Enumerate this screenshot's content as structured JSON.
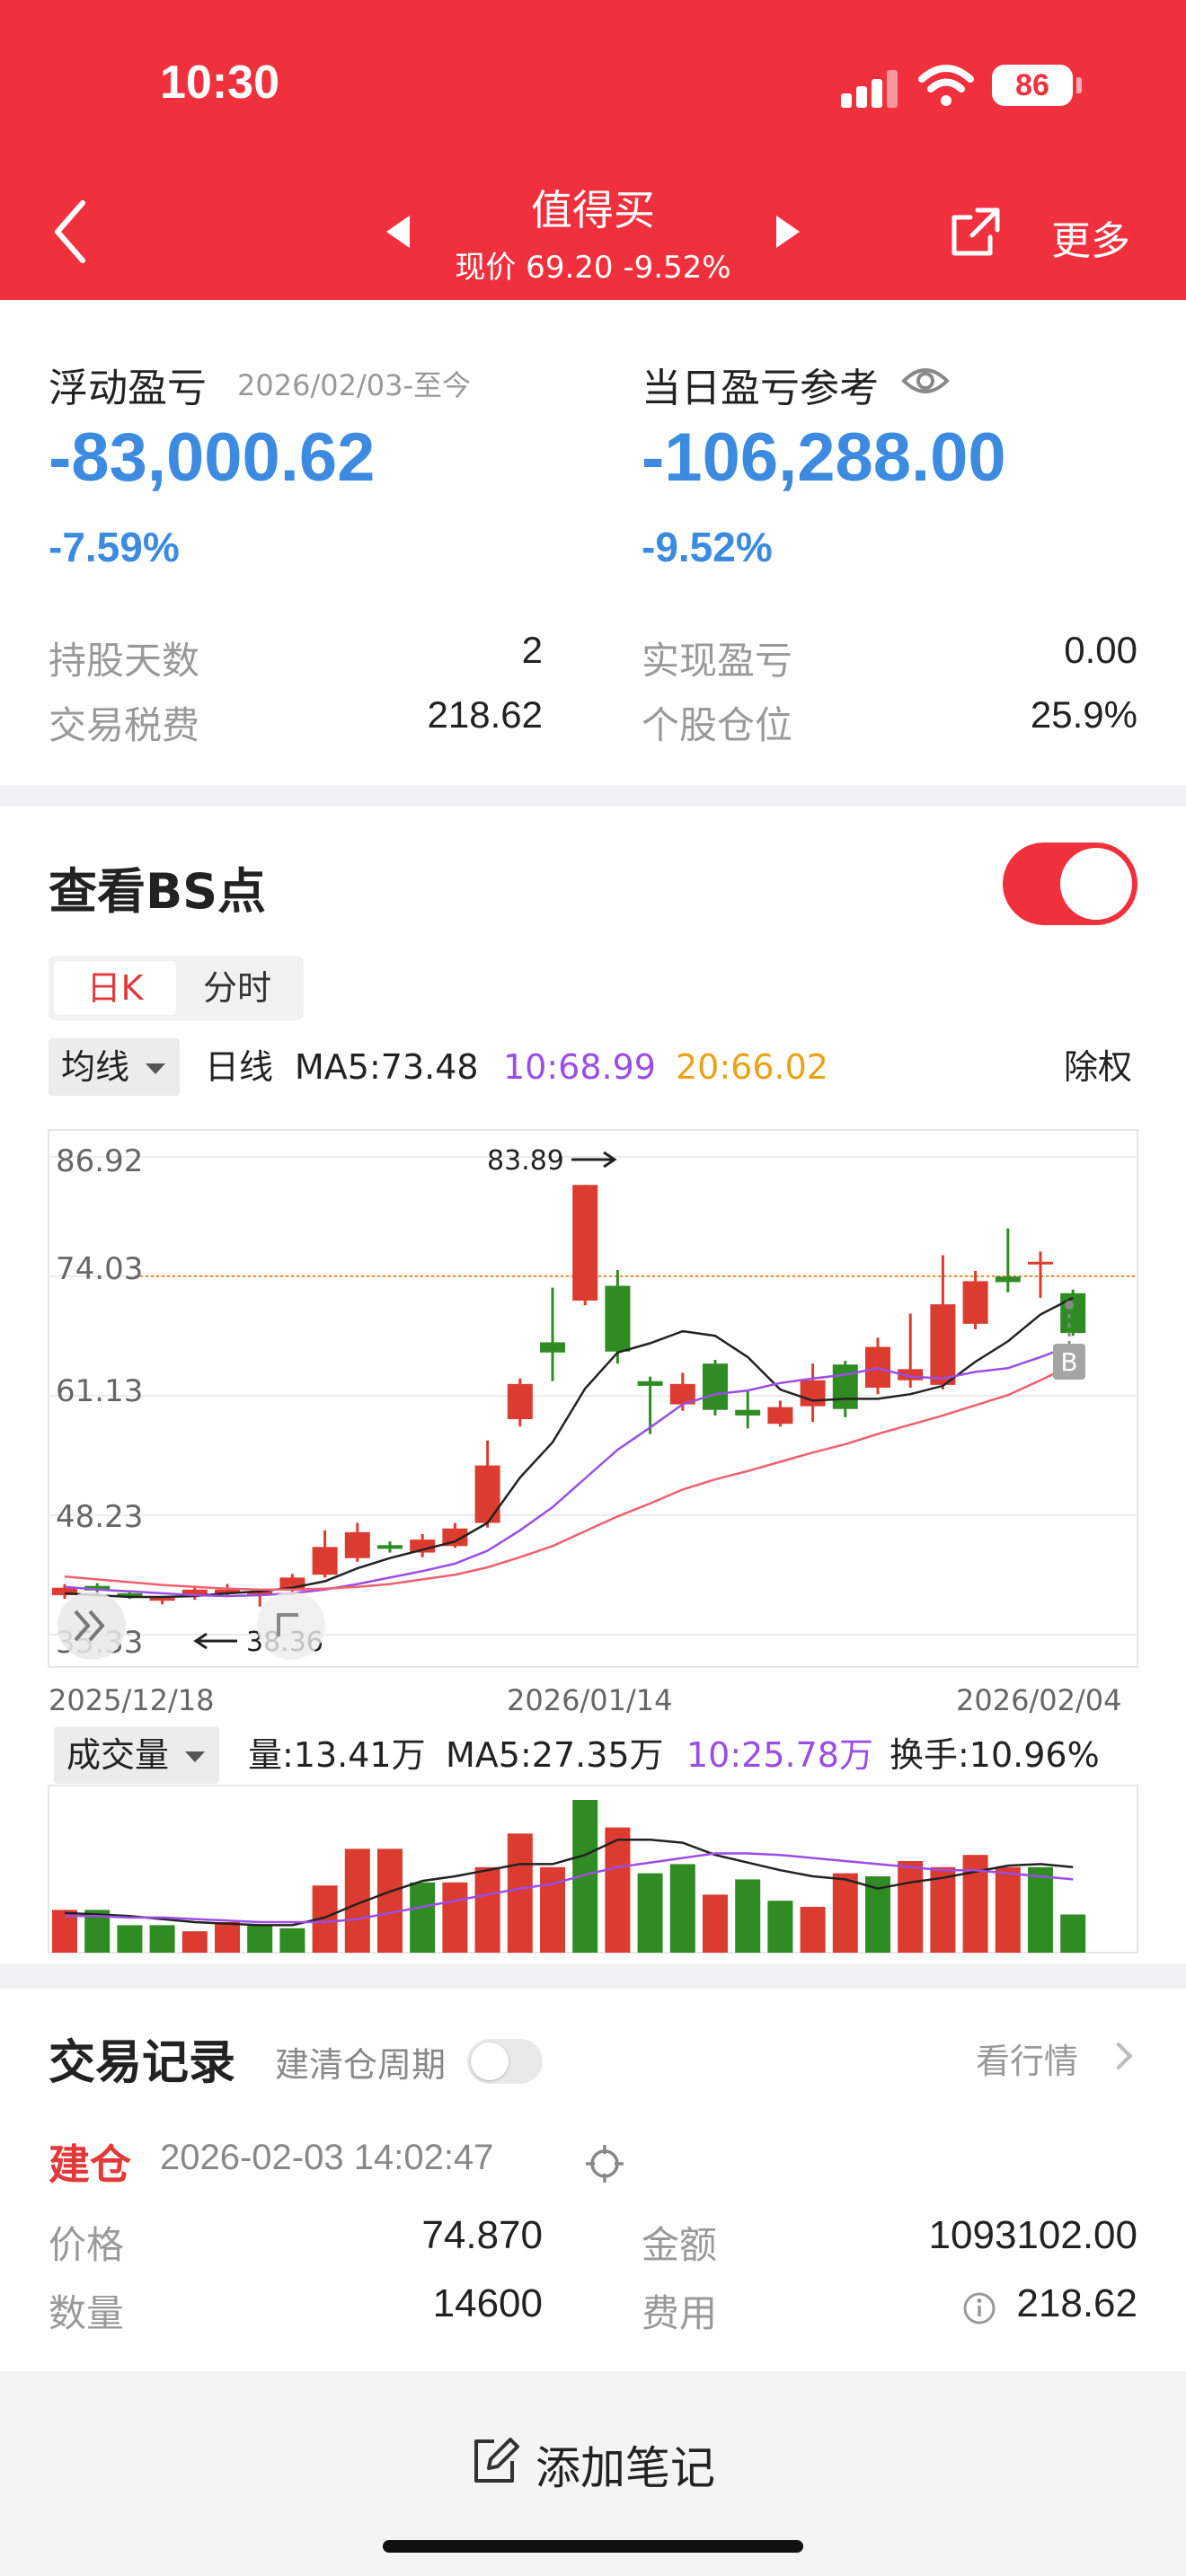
{
  "status_bar": {
    "time": "10:30",
    "battery": "86"
  },
  "header": {
    "stock_name": "值得买",
    "price_line": "现价 69.20 -9.52%",
    "more_label": "更多",
    "bg_color": "#f0313d"
  },
  "pnl": {
    "floating_label": "浮动盈亏",
    "floating_period": "2026/02/03-至今",
    "floating_value": "-83,000.62",
    "floating_pct": "-7.59%",
    "daily_label": "当日盈亏参考",
    "daily_value": "-106,288.00",
    "daily_pct": "-9.52%",
    "hold_days_label": "持股天数",
    "hold_days": "2",
    "fees_label": "交易税费",
    "fees": "218.62",
    "realized_label": "实现盈亏",
    "realized": "0.00",
    "position_label": "个股仓位",
    "position": "25.9%"
  },
  "chart_panel": {
    "title": "查看BS点",
    "toggle_on": true,
    "tabs": [
      "日K",
      "分时"
    ],
    "active_tab": "日K",
    "ma_dropdown": "均线",
    "period": "日线",
    "ma5": "MA5:73.48",
    "ma10": "10:68.99",
    "ma20": "20:66.02",
    "adjust": "除权",
    "price_ticks": [
      "86.92",
      "74.03",
      "61.13",
      "48.23",
      "35.33"
    ],
    "high_label": "83.89",
    "low_label": "38.36",
    "dates": [
      "2025/12/18",
      "2026/01/14",
      "2026/02/04"
    ],
    "buy_marker": "B",
    "vol_dropdown": "成交量",
    "vol": "量:13.41万",
    "vol_ma5": "MA5:27.35万",
    "vol_ma10": "10:25.78万",
    "turnover": "换手:10.96%",
    "colors": {
      "up": "#dc3b30",
      "down": "#2f8c23",
      "ma5": "#222222",
      "ma10": "#9b4de6",
      "ma20": "#f0606e"
    }
  },
  "trades": {
    "title": "交易记录",
    "cycle_label": "建清仓周期",
    "market_link": "看行情",
    "record_type": "建仓",
    "record_time": "2026-02-03 14:02:47",
    "price_label": "价格",
    "price": "74.870",
    "amount_label": "金额",
    "amount": "1093102.00",
    "qty_label": "数量",
    "qty": "14600",
    "fee_label": "费用",
    "fee": "218.62"
  },
  "bottom": {
    "add_note": "添加笔记"
  },
  "chart_data": [
    {
      "type": "candlestick",
      "title": "",
      "ylim": [
        35.33,
        86.92
      ],
      "y_ticks": [
        86.92,
        74.03,
        61.13,
        48.23,
        35.33
      ],
      "x_ticks": [
        "2025/12/18",
        "2026/01/14",
        "2026/02/04"
      ],
      "reference_line": 74.03,
      "annotations": [
        {
          "text": "83.89",
          "value": 83.89
        },
        {
          "text": "38.36",
          "value": 38.36
        }
      ],
      "candles": [
        {
          "o": 39.6,
          "c": 40.4,
          "h": 40.8,
          "l": 39.2,
          "up": true
        },
        {
          "o": 40.6,
          "c": 40.1,
          "h": 40.9,
          "l": 39.7,
          "up": false
        },
        {
          "o": 39.8,
          "c": 39.5,
          "h": 40.1,
          "l": 39.2,
          "up": false
        },
        {
          "o": 39.0,
          "c": 39.3,
          "h": 39.5,
          "l": 38.6,
          "up": true
        },
        {
          "o": 39.5,
          "c": 40.2,
          "h": 40.6,
          "l": 39.1,
          "up": true
        },
        {
          "o": 39.8,
          "c": 40.2,
          "h": 40.8,
          "l": 39.4,
          "up": true
        },
        {
          "o": 39.8,
          "c": 40.0,
          "h": 40.3,
          "l": 38.36,
          "up": true
        },
        {
          "o": 40.1,
          "c": 41.5,
          "h": 41.9,
          "l": 39.6,
          "up": true
        },
        {
          "o": 41.8,
          "c": 44.8,
          "h": 46.6,
          "l": 41.5,
          "up": true
        },
        {
          "o": 43.6,
          "c": 46.4,
          "h": 47.4,
          "l": 43.2,
          "up": true
        },
        {
          "o": 45.0,
          "c": 44.6,
          "h": 45.4,
          "l": 44.2,
          "up": false
        },
        {
          "o": 44.2,
          "c": 45.6,
          "h": 46.2,
          "l": 43.7,
          "up": true
        },
        {
          "o": 44.9,
          "c": 46.8,
          "h": 47.4,
          "l": 44.7,
          "up": true
        },
        {
          "o": 47.4,
          "c": 53.6,
          "h": 56.3,
          "l": 46.9,
          "up": true
        },
        {
          "o": 58.6,
          "c": 62.4,
          "h": 63.0,
          "l": 57.8,
          "up": true
        },
        {
          "o": 66.9,
          "c": 65.8,
          "h": 72.8,
          "l": 62.7,
          "up": false
        },
        {
          "o": 71.4,
          "c": 83.89,
          "h": 83.89,
          "l": 70.9,
          "up": true
        },
        {
          "o": 73.0,
          "c": 65.9,
          "h": 74.7,
          "l": 64.6,
          "up": false
        },
        {
          "o": 62.7,
          "c": 62.2,
          "h": 63.2,
          "l": 57.0,
          "up": false
        },
        {
          "o": 60.2,
          "c": 62.4,
          "h": 63.6,
          "l": 59.5,
          "up": true
        },
        {
          "o": 64.6,
          "c": 59.6,
          "h": 65.0,
          "l": 59.0,
          "up": false
        },
        {
          "o": 59.6,
          "c": 59.0,
          "h": 61.8,
          "l": 57.6,
          "up": false
        },
        {
          "o": 58.1,
          "c": 59.9,
          "h": 60.6,
          "l": 57.8,
          "up": true
        },
        {
          "o": 60.0,
          "c": 62.8,
          "h": 64.6,
          "l": 58.3,
          "up": true
        },
        {
          "o": 64.5,
          "c": 59.7,
          "h": 64.9,
          "l": 58.8,
          "up": false
        },
        {
          "o": 62.0,
          "c": 66.4,
          "h": 67.4,
          "l": 61.3,
          "up": true
        },
        {
          "o": 62.8,
          "c": 64.0,
          "h": 70.0,
          "l": 62.0,
          "up": true
        },
        {
          "o": 62.3,
          "c": 71.0,
          "h": 76.3,
          "l": 61.8,
          "up": true
        },
        {
          "o": 68.9,
          "c": 73.5,
          "h": 74.6,
          "l": 68.3,
          "up": true
        },
        {
          "o": 74.0,
          "c": 73.4,
          "h": 79.2,
          "l": 72.3,
          "up": false
        },
        {
          "o": 75.6,
          "c": 75.4,
          "h": 76.7,
          "l": 71.7,
          "up": true
        },
        {
          "o": 72.2,
          "c": 67.9,
          "h": 72.6,
          "l": 67.6,
          "up": false
        }
      ],
      "series": [
        {
          "name": "MA5",
          "values": [
            39.8,
            39.6,
            39.4,
            39.4,
            39.5,
            39.8,
            40.0,
            40.4,
            41.1,
            42.5,
            43.6,
            44.5,
            45.4,
            47.4,
            52.3,
            56.1,
            61.9,
            65.8,
            66.8,
            68.1,
            67.6,
            65.3,
            61.8,
            60.6,
            60.8,
            60.8,
            61.3,
            62.2,
            64.8,
            67.0,
            69.9,
            71.7
          ]
        },
        {
          "name": "MA10",
          "values": [
            40.5,
            40.2,
            40.0,
            39.8,
            39.6,
            39.5,
            39.6,
            39.8,
            40.2,
            40.8,
            41.5,
            42.2,
            43.0,
            44.4,
            46.6,
            49.1,
            52.2,
            55.3,
            57.7,
            60.2,
            61.3,
            61.7,
            62.5,
            63.0,
            63.4,
            64.1,
            63.2,
            63.0,
            63.7,
            64.1,
            65.3,
            66.6
          ]
        },
        {
          "name": "MA20",
          "values": [
            41.6,
            41.3,
            41.0,
            40.7,
            40.5,
            40.3,
            40.2,
            40.2,
            40.3,
            40.5,
            40.8,
            41.3,
            41.8,
            42.6,
            43.7,
            44.9,
            46.5,
            48.1,
            49.5,
            51.0,
            52.1,
            53.0,
            54.0,
            55.0,
            55.9,
            57.0,
            58.0,
            59.0,
            60.1,
            61.2,
            62.8,
            64.5
          ]
        }
      ]
    },
    {
      "type": "bar",
      "title": "",
      "ylim": [
        0,
        100
      ],
      "values": [
        28,
        28,
        18,
        18,
        14,
        20,
        18,
        16,
        44,
        68,
        68,
        46,
        46,
        56,
        78,
        56,
        100,
        82,
        52,
        58,
        38,
        48,
        34,
        30,
        52,
        50,
        60,
        56,
        64,
        56,
        56,
        25
      ],
      "up": [
        true,
        false,
        false,
        false,
        true,
        true,
        false,
        false,
        true,
        true,
        true,
        false,
        true,
        true,
        true,
        true,
        false,
        true,
        false,
        false,
        true,
        false,
        false,
        true,
        true,
        false,
        true,
        true,
        true,
        true,
        false,
        false
      ],
      "series": [
        {
          "name": "MA5",
          "values": [
            26,
            25,
            24,
            22,
            20,
            19,
            18,
            18,
            23,
            32,
            40,
            47,
            50,
            54,
            58,
            58,
            64,
            74,
            74,
            72,
            64,
            59,
            54,
            50,
            48,
            42,
            46,
            49,
            53,
            57,
            58,
            56,
            52
          ]
        },
        {
          "name": "MA10",
          "values": [
            24,
            24,
            23,
            23,
            22,
            21,
            20,
            20,
            20,
            22,
            26,
            30,
            34,
            38,
            42,
            45,
            51,
            56,
            59,
            62,
            65,
            65,
            64,
            62,
            60,
            58,
            56,
            54,
            54,
            52,
            50,
            48
          ]
        }
      ]
    }
  ]
}
